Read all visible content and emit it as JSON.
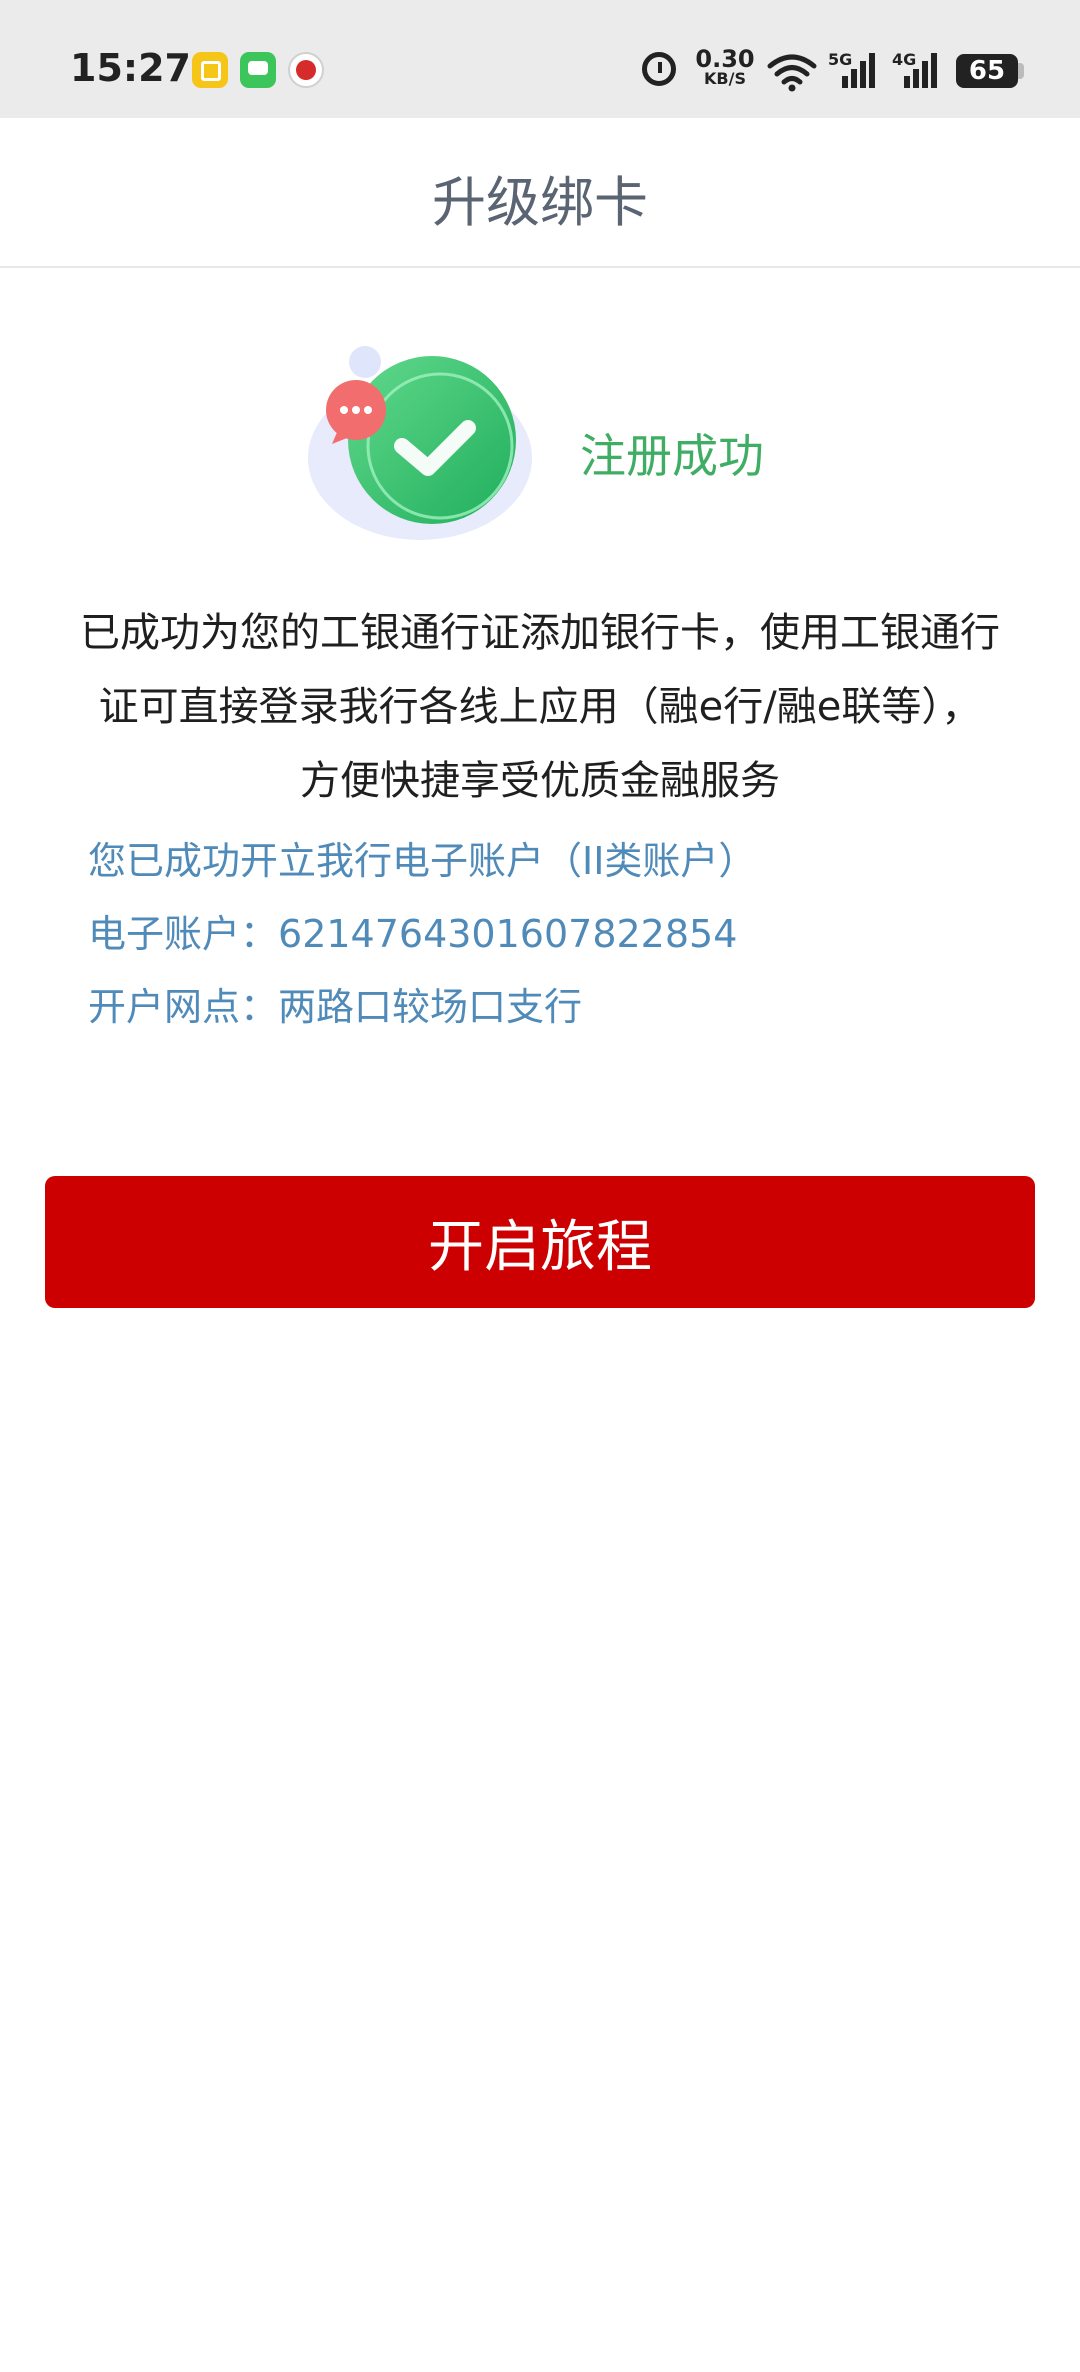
{
  "status_bar": {
    "time": "15:27",
    "net_speed_value": "0.30",
    "net_speed_unit": "KB/S",
    "signal_1_label": "5G",
    "signal_2_label": "4G",
    "battery": "65"
  },
  "header": {
    "title": "升级绑卡"
  },
  "success": {
    "text": "注册成功"
  },
  "content": {
    "description": "已成功为您的工银通行证添加银行卡，使用工银通行证可直接登录我行各线上应用（融e行/融e联等），方便快捷享受优质金融服务",
    "account_opened": "您已成功开立我行电子账户（II类账户）",
    "account_label": "电子账户：",
    "account_number": "6214764301607822854",
    "branch_label": "开户网点：",
    "branch_name": "两路口较场口支行"
  },
  "actions": {
    "start_label": "开启旅程"
  },
  "colors": {
    "primary": "#cc0000",
    "success_green": "#3fae64",
    "info_blue": "#4f8ab8"
  }
}
